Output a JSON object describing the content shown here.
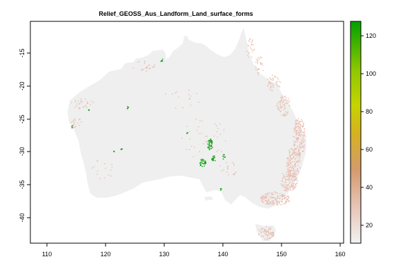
{
  "title": "Relief_GEOSS_Aus_Landform_Land_surface_forms",
  "chart_data": {
    "type": "heatmap",
    "title": "Relief_GEOSS_Aus_Landform_Land_surface_forms",
    "x_axis": {
      "ticks": [
        "110",
        "120",
        "130",
        "140",
        "150",
        "160"
      ],
      "range": [
        107,
        160
      ]
    },
    "y_axis": {
      "ticks": [
        "-15",
        "-20",
        "-25",
        "-30",
        "-35",
        "-40"
      ],
      "range": [
        -44,
        -10
      ],
      "tick_label_orientation": "vertical"
    },
    "legend": {
      "type": "colorbar",
      "placement": "right",
      "ticks": [
        "20",
        "40",
        "60",
        "80",
        "100",
        "120"
      ],
      "range": [
        10,
        128
      ],
      "colors": [
        "#f2f2f2",
        "#e8c8b8",
        "#d59a6a",
        "#cccc00",
        "#8acb00",
        "#00a300"
      ]
    },
    "grid": false,
    "base_color": "#efefef",
    "low_value_color": "#e8b8aa",
    "high_value_color": "#14a014"
  }
}
